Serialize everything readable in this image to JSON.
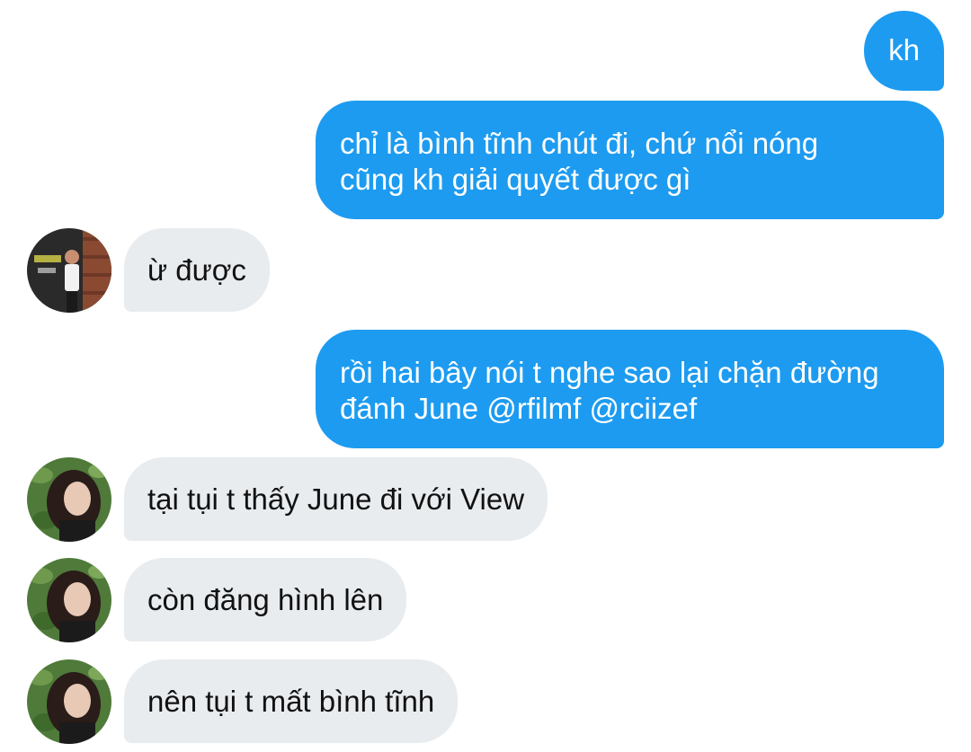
{
  "colors": {
    "outgoing_bubble": "#1d9bf0",
    "incoming_bubble": "#e8ecef",
    "outgoing_text": "#ffffff",
    "incoming_text": "#111111"
  },
  "messages": [
    {
      "direction": "outgoing",
      "lines": [
        "kh"
      ]
    },
    {
      "direction": "outgoing",
      "lines": [
        "chỉ là bình tĩnh chút đi, chứ nổi nóng",
        "cũng kh giải quyết được gì"
      ]
    },
    {
      "direction": "incoming",
      "avatar": "avatar-male-photo",
      "lines": [
        "ừ được"
      ]
    },
    {
      "direction": "outgoing",
      "lines": [
        "rồi hai bây nói t nghe sao lại chặn đường",
        "đánh June @rfilmf @rciizef"
      ]
    },
    {
      "direction": "incoming",
      "avatar": "avatar-female-photo",
      "lines": [
        "tại tụi t thấy June đi với View"
      ]
    },
    {
      "direction": "incoming",
      "avatar": "avatar-female-photo",
      "lines": [
        "còn đăng hình lên"
      ]
    },
    {
      "direction": "incoming",
      "avatar": "avatar-female-photo",
      "lines": [
        "nên tụi t mất bình tĩnh"
      ]
    }
  ]
}
